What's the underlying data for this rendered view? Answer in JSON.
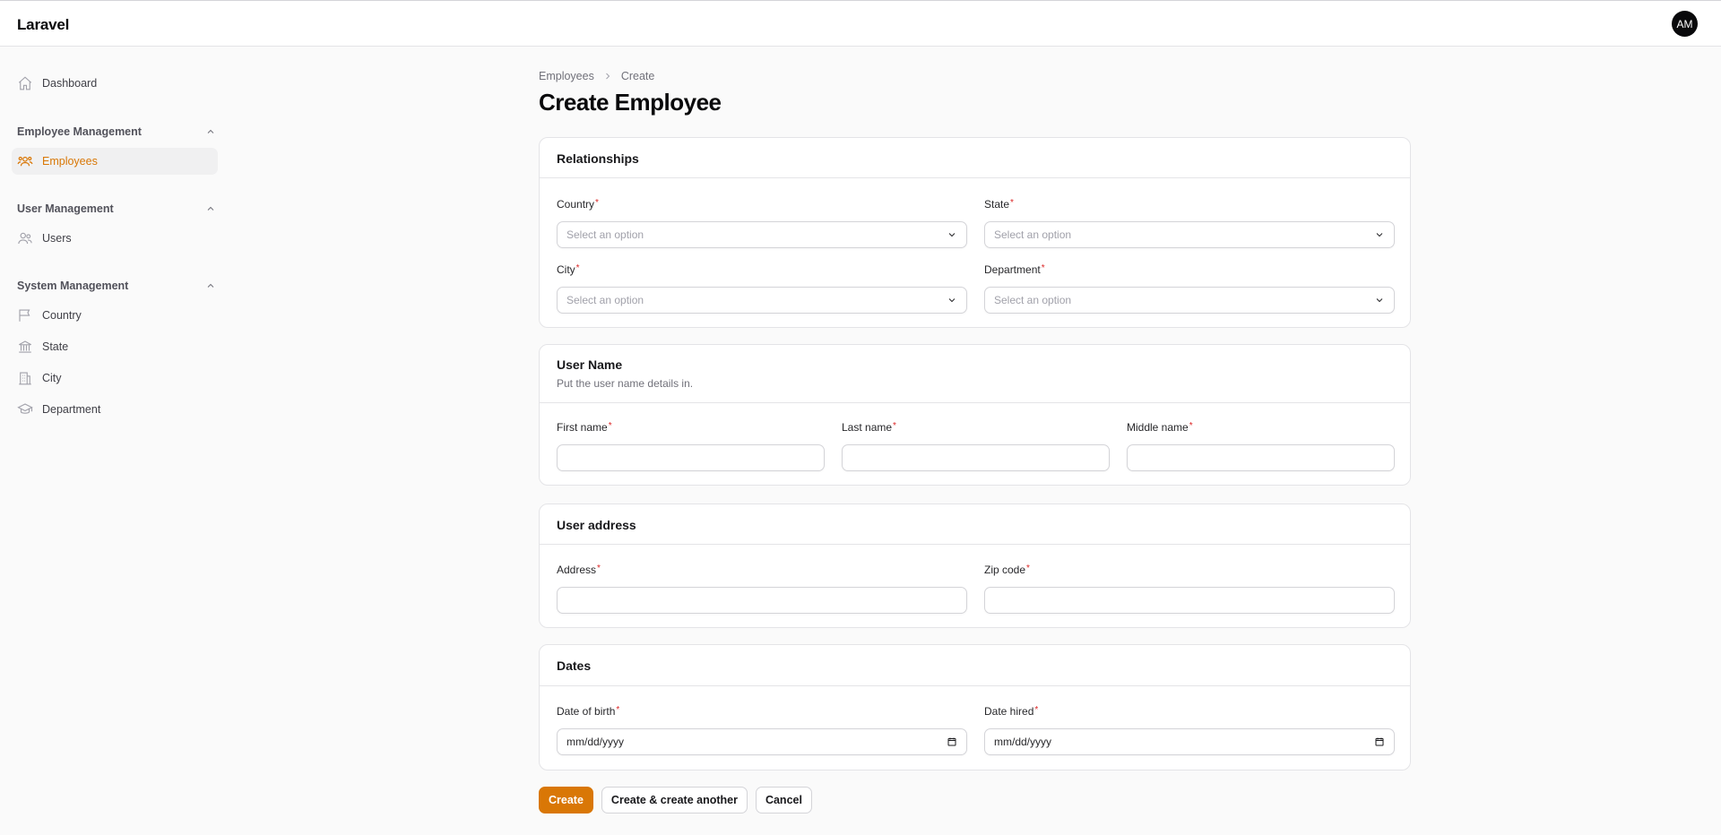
{
  "app": {
    "brand": "Laravel",
    "avatar_initials": "AM",
    "accent": "#d97706"
  },
  "sidebar": {
    "dashboard": "Dashboard",
    "groups": [
      {
        "label": "Employee Management",
        "items": [
          "Employees"
        ]
      },
      {
        "label": "User Management",
        "items": [
          "Users"
        ]
      },
      {
        "label": "System Management",
        "items": [
          "Country",
          "State",
          "City",
          "Department"
        ]
      }
    ],
    "active_item": "Employees"
  },
  "breadcrumb": [
    "Employees",
    "Create"
  ],
  "page_title": "Create Employee",
  "sections": {
    "relationships": {
      "title": "Relationships",
      "fields": [
        {
          "label": "Country",
          "placeholder": "Select an option"
        },
        {
          "label": "State",
          "placeholder": "Select an option"
        },
        {
          "label": "City",
          "placeholder": "Select an option"
        },
        {
          "label": "Department",
          "placeholder": "Select an option"
        }
      ]
    },
    "user_name": {
      "title": "User Name",
      "description": "Put the user name details in.",
      "fields": [
        {
          "label": "First name",
          "value": ""
        },
        {
          "label": "Last name",
          "value": ""
        },
        {
          "label": "Middle name",
          "value": ""
        }
      ]
    },
    "user_address": {
      "title": "User address",
      "fields": [
        {
          "label": "Address",
          "value": ""
        },
        {
          "label": "Zip code",
          "value": ""
        }
      ]
    },
    "dates": {
      "title": "Dates",
      "fields": [
        {
          "label": "Date of birth",
          "placeholder": "mm/dd/yyyy"
        },
        {
          "label": "Date hired",
          "placeholder": "mm/dd/yyyy"
        }
      ]
    }
  },
  "required_marker": "*",
  "actions": {
    "create": "Create",
    "create_another": "Create & create another",
    "cancel": "Cancel"
  }
}
